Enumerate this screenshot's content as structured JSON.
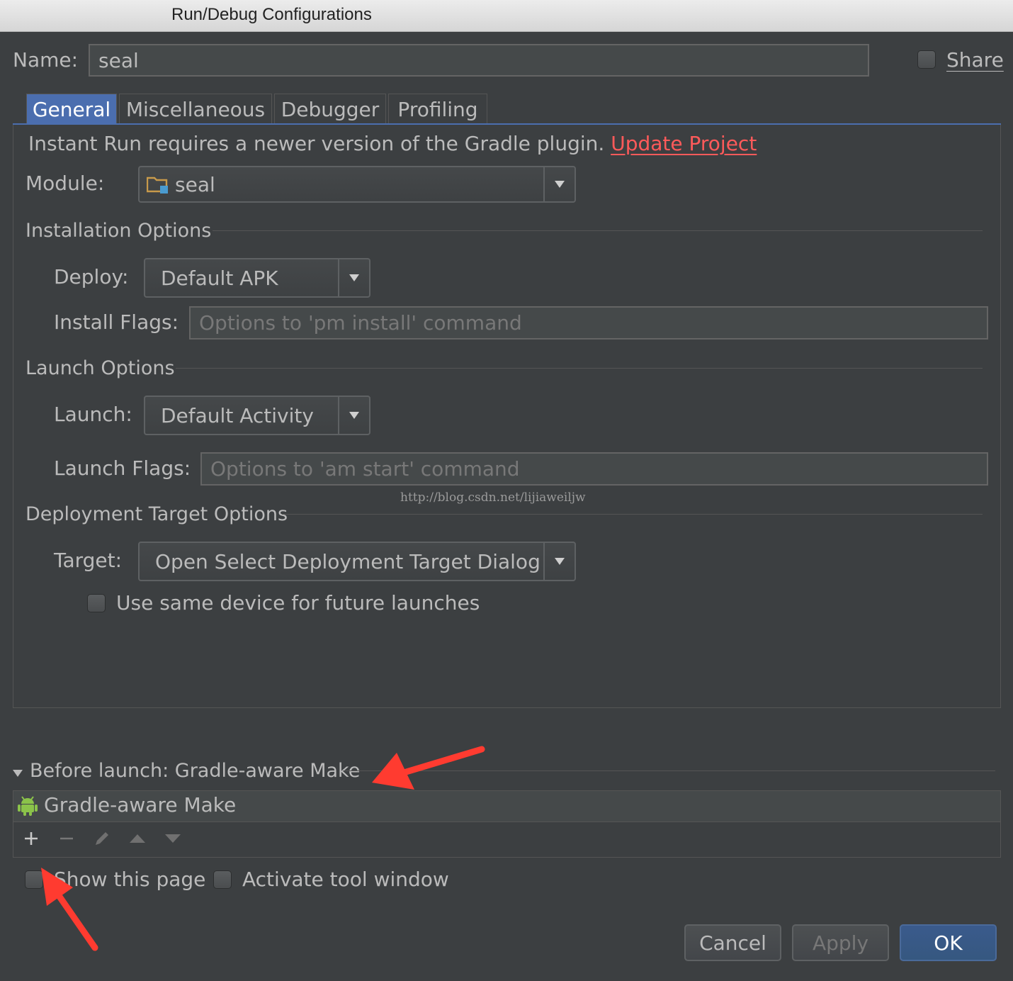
{
  "window": {
    "title": "Run/Debug Configurations"
  },
  "name_row": {
    "label": "Name:",
    "value": "seal",
    "share_label": "Share"
  },
  "tabs": [
    {
      "label": "General",
      "active": true
    },
    {
      "label": "Miscellaneous",
      "active": false
    },
    {
      "label": "Debugger",
      "active": false
    },
    {
      "label": "Profiling",
      "active": false
    }
  ],
  "general": {
    "notice": "Instant Run requires a newer version of the Gradle plugin.",
    "notice_link": "Update Project",
    "module_label": "Module:",
    "module_value": "seal",
    "installation_options": {
      "title": "Installation Options",
      "deploy_label": "Deploy:",
      "deploy_value": "Default APK",
      "install_flags_label": "Install Flags:",
      "install_flags_placeholder": "Options to 'pm install' command"
    },
    "launch_options": {
      "title": "Launch Options",
      "launch_label": "Launch:",
      "launch_value": "Default Activity",
      "launch_flags_label": "Launch Flags:",
      "launch_flags_placeholder": "Options to 'am start' command"
    },
    "watermark": "http://blog.csdn.net/lijiaweiljw",
    "deployment_target": {
      "title": "Deployment Target Options",
      "target_label": "Target:",
      "target_value": "Open Select Deployment Target Dialog",
      "same_device_label": "Use same device for future launches"
    }
  },
  "before_launch": {
    "title": "Before launch: Gradle-aware Make",
    "items": [
      "Gradle-aware Make"
    ],
    "show_page_label": "Show this page",
    "activate_tool_window_label": "Activate tool window"
  },
  "buttons": {
    "cancel": "Cancel",
    "apply": "Apply",
    "ok": "OK"
  },
  "colors": {
    "link": "#ff5a5a",
    "annotation_arrow": "#ff3b30",
    "active_tab": "#4b6eaf"
  }
}
